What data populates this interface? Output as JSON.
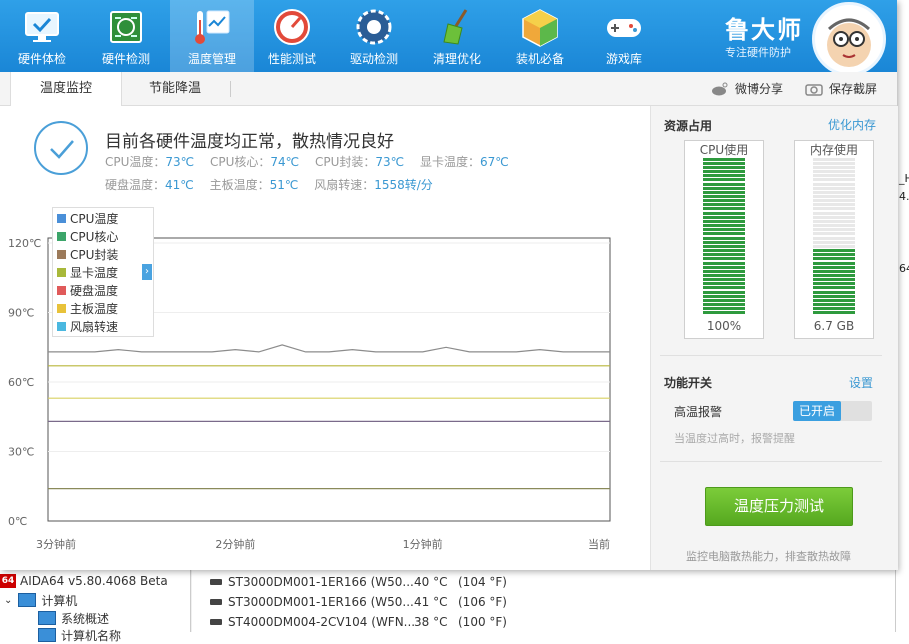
{
  "app": {
    "brand_name": "鲁大师",
    "brand_sub": "专注硬件防护"
  },
  "toolbar": [
    {
      "label": "硬件体检",
      "icon": "monitor-check-icon"
    },
    {
      "label": "硬件检测",
      "icon": "circuit-board-icon"
    },
    {
      "label": "温度管理",
      "icon": "thermometer-icon"
    },
    {
      "label": "性能测试",
      "icon": "speedometer-icon"
    },
    {
      "label": "驱动检测",
      "icon": "gear-shield-icon"
    },
    {
      "label": "清理优化",
      "icon": "broom-icon"
    },
    {
      "label": "装机必备",
      "icon": "package-box-icon"
    },
    {
      "label": "游戏库",
      "icon": "gamepad-icon"
    }
  ],
  "tabs": {
    "monitor": "温度监控",
    "saving": "节能降温",
    "weibo_share": "微博分享",
    "save_screenshot": "保存截屏"
  },
  "status": {
    "title": "目前各硬件温度均正常，散热情况良好",
    "cpu_temp_label": "CPU温度：",
    "cpu_temp": "73℃",
    "cpu_core_label": "CPU核心：",
    "cpu_core": "74℃",
    "cpu_pkg_label": "CPU封装：",
    "cpu_pkg": "73℃",
    "gpu_label": "显卡温度：",
    "gpu": "67℃",
    "disk_label": "硬盘温度：",
    "disk": "41℃",
    "board_label": "主板温度：",
    "board": "51℃",
    "fan_label": "风扇转速：",
    "fan": "1558转/分"
  },
  "legend": [
    {
      "name": "CPU温度",
      "color": "#4a8fd8"
    },
    {
      "name": "CPU核心",
      "color": "#3ca56a"
    },
    {
      "name": "CPU封装",
      "color": "#9c7a5a"
    },
    {
      "name": "显卡温度",
      "color": "#a8b83a"
    },
    {
      "name": "硬盘温度",
      "color": "#e05a5a"
    },
    {
      "name": "主板温度",
      "color": "#e8c23a"
    },
    {
      "name": "风扇转速",
      "color": "#4ab8e0"
    }
  ],
  "chart_data": {
    "type": "line",
    "x_ticks": [
      "3分钟前",
      "2分钟前",
      "1分钟前",
      "当前"
    ],
    "y_ticks": [
      "0℃",
      "30℃",
      "60℃",
      "90℃",
      "120℃"
    ],
    "ylim": [
      0,
      120
    ],
    "grid": true,
    "legend_position": "top-left",
    "series": [
      {
        "name": "CPU温度",
        "color": "#8c8c8c",
        "values": [
          73,
          73,
          73,
          74,
          73,
          73,
          73,
          73,
          74,
          73,
          76,
          73,
          73,
          74,
          73,
          73,
          73,
          75,
          73,
          73,
          73,
          74,
          73,
          73,
          73
        ]
      },
      {
        "name": "显卡温度",
        "color": "#b8b63a",
        "values": [
          67,
          67,
          67,
          67,
          67,
          67,
          67,
          67,
          67,
          67,
          67,
          67,
          67,
          67,
          67,
          67,
          67,
          67,
          67,
          67,
          67,
          67,
          67,
          67,
          67
        ]
      },
      {
        "name": "主板温度",
        "color": "#d8d060",
        "values": [
          53,
          53,
          53,
          53,
          53,
          53,
          53,
          53,
          53,
          53,
          53,
          53,
          53,
          53,
          53,
          53,
          53,
          53,
          53,
          53,
          53,
          53,
          53,
          53,
          53
        ]
      },
      {
        "name": "硬盘温度",
        "color": "#7a6a8a",
        "values": [
          43,
          43,
          43,
          43,
          43,
          43,
          43,
          43,
          43,
          43,
          43,
          43,
          43,
          43,
          43,
          43,
          43,
          43,
          43,
          43,
          43,
          43,
          43,
          43,
          43
        ]
      },
      {
        "name": "风扇转速",
        "color": "#8a8a5a",
        "values": [
          14,
          14,
          14,
          14,
          14,
          14,
          14,
          14,
          14,
          14,
          14,
          14,
          14,
          14,
          14,
          14,
          14,
          14,
          14,
          14,
          14,
          14,
          14,
          14,
          14
        ]
      }
    ]
  },
  "resources": {
    "title": "资源占用",
    "optimize_link": "优化内存",
    "cpu_label": "CPU使用",
    "cpu_value": "100%",
    "cpu_fraction": 1.0,
    "mem_label": "内存使用",
    "mem_value": "6.7 GB",
    "mem_fraction": 0.42,
    "bar_color": "#2e9a3e"
  },
  "functions": {
    "title": "功能开关",
    "settings": "设置",
    "alarm_label": "高温报警",
    "alarm_state": "已开启",
    "alarm_hint": "当温度过高时，报警提醒",
    "stress_button": "温度压力测试",
    "footer_note": "监控电脑散热能力，排查散热故障"
  },
  "background": {
    "aida_title": "AIDA64 v5.80.4068 Beta",
    "computer": "计算机",
    "summary": "系统概述",
    "partial": "计算机名称",
    "disks": [
      {
        "name": "ST3000DM001-1ER166 (W50...",
        "c": "40 °C",
        "f": "(104 °F)"
      },
      {
        "name": "ST3000DM001-1ER166 (W50...",
        "c": "41 °C",
        "f": "(106 °F)"
      },
      {
        "name": "ST4000DM004-2CV104 (WFN...",
        "c": "38 °C",
        "f": "(100 °F)"
      }
    ],
    "edge_fragments": [
      "_H",
      "4.",
      "64"
    ]
  }
}
